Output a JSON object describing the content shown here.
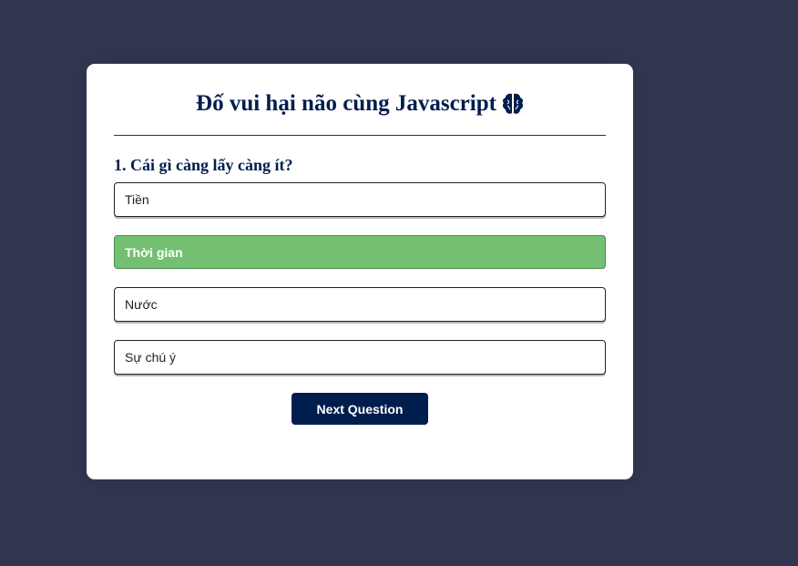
{
  "quiz": {
    "title": "Đố vui hại não cùng Javascript",
    "title_icon": "brain-icon",
    "question_number": "1.",
    "question_text": "Cái gì càng lấy càng ít?",
    "answers": [
      {
        "label": "Tiền",
        "state": "default"
      },
      {
        "label": "Thời gian",
        "state": "correct"
      },
      {
        "label": "Nước",
        "state": "default"
      },
      {
        "label": "Sự chú ý",
        "state": "default"
      }
    ],
    "next_label": "Next Question"
  },
  "colors": {
    "background": "#323651",
    "card": "#ffffff",
    "primary": "#001e4d",
    "correct": "#73c072"
  }
}
